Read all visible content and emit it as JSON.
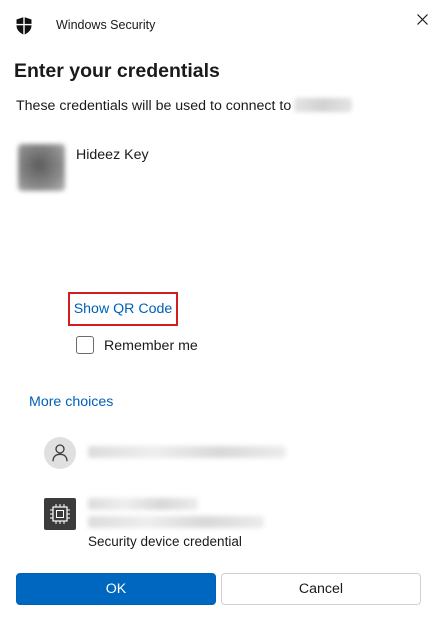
{
  "titlebar": {
    "app_title": "Windows Security",
    "icon": "shield-icon",
    "close_icon": "close-icon"
  },
  "dialog": {
    "heading": "Enter your credentials",
    "connect_text": "These credentials will be used to connect to"
  },
  "credential": {
    "name": "Hideez Key",
    "qr_link": "Show QR Code",
    "remember_label": "Remember me",
    "remember_checked": false
  },
  "more_choices": {
    "label": "More choices",
    "options": [
      {
        "icon": "user-icon"
      },
      {
        "icon": "chip-icon",
        "label": "Security device credential"
      }
    ]
  },
  "buttons": {
    "ok": "OK",
    "cancel": "Cancel"
  },
  "colors": {
    "accent": "#0067c0",
    "link": "#005fb8",
    "highlight_border": "#d11f1f"
  }
}
